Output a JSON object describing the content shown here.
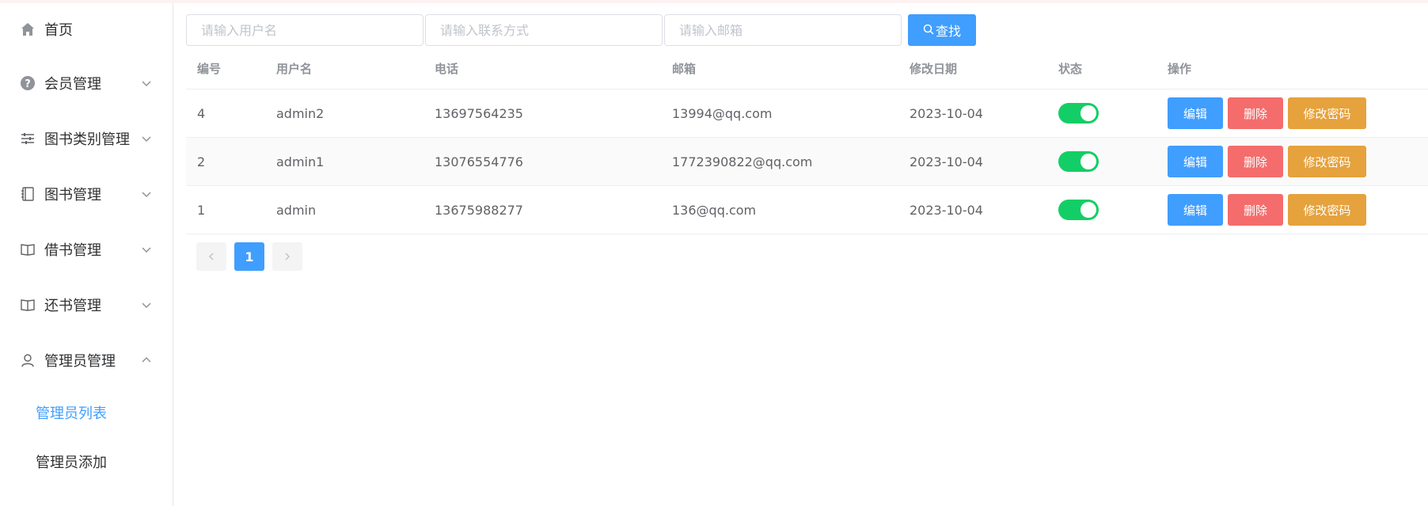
{
  "sidebar": {
    "items": [
      {
        "label": "首页",
        "icon": "home-icon"
      },
      {
        "label": "会员管理",
        "icon": "question-circle-icon"
      },
      {
        "label": "图书类别管理",
        "icon": "sliders-icon"
      },
      {
        "label": "图书管理",
        "icon": "notebook-icon"
      },
      {
        "label": "借书管理",
        "icon": "reading-icon"
      },
      {
        "label": "还书管理",
        "icon": "reading-icon"
      },
      {
        "label": "管理员管理",
        "icon": "user-icon"
      }
    ],
    "submenu": [
      {
        "label": "管理员列表",
        "active": true
      },
      {
        "label": "管理员添加",
        "active": false
      }
    ]
  },
  "search": {
    "username_placeholder": "请输入用户名",
    "phone_placeholder": "请输入联系方式",
    "email_placeholder": "请输入邮箱",
    "button_label": "查找"
  },
  "table": {
    "headers": {
      "id": "编号",
      "username": "用户名",
      "phone": "电话",
      "email": "邮箱",
      "date": "修改日期",
      "status": "状态",
      "ops": "操作"
    },
    "rows": [
      {
        "id": "4",
        "username": "admin2",
        "phone": "13697564235",
        "email": "13994@qq.com",
        "date": "2023-10-04",
        "status": true
      },
      {
        "id": "2",
        "username": "admin1",
        "phone": "13076554776",
        "email": "1772390822@qq.com",
        "date": "2023-10-04",
        "status": true
      },
      {
        "id": "1",
        "username": "admin",
        "phone": "13675988277",
        "email": "136@qq.com",
        "date": "2023-10-04",
        "status": true
      }
    ],
    "ops_labels": {
      "edit": "编辑",
      "delete": "删除",
      "password": "修改密码"
    }
  },
  "pagination": {
    "current_page": "1",
    "prev_icon": "chevron-left-icon",
    "next_icon": "chevron-right-icon"
  },
  "colors": {
    "primary": "#409eff",
    "danger": "#f56c6c",
    "warning": "#e6a23c",
    "switch_on": "#13ce66"
  }
}
